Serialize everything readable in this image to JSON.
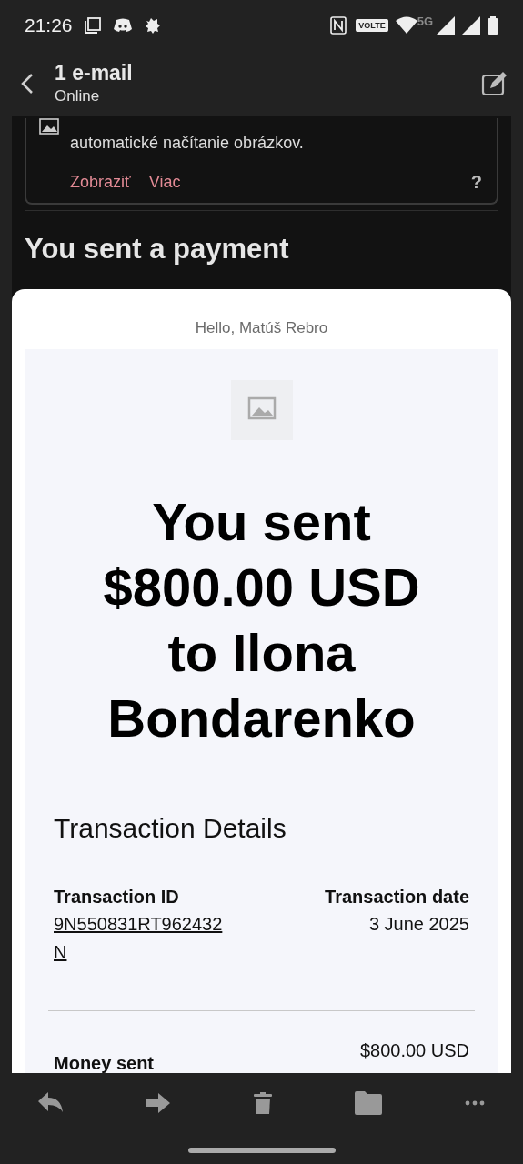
{
  "status_bar": {
    "time": "21:26",
    "network": "5G",
    "volte": "VOLTE"
  },
  "header": {
    "title": "1 e-mail",
    "subtitle": "Online"
  },
  "privacy_banner": {
    "message": "automatické načítanie obrázkov.",
    "actions": [
      "Zobraziť",
      "Viac"
    ],
    "help": "?"
  },
  "subject": "You sent a payment",
  "email": {
    "greeting": "Hello, Matúš Rebro",
    "headline": "You sent $800.00 USD to Ilona Bondarenko",
    "section_title": "Transaction Details",
    "details": [
      {
        "label": "Transaction ID",
        "value": "9N550831RT962432N",
        "kind": "link"
      },
      {
        "label": "Transaction date",
        "value": "3 June 2025",
        "kind": "text"
      }
    ],
    "money_sent": {
      "label": "Money sent",
      "value": "$800.00 USD"
    }
  }
}
